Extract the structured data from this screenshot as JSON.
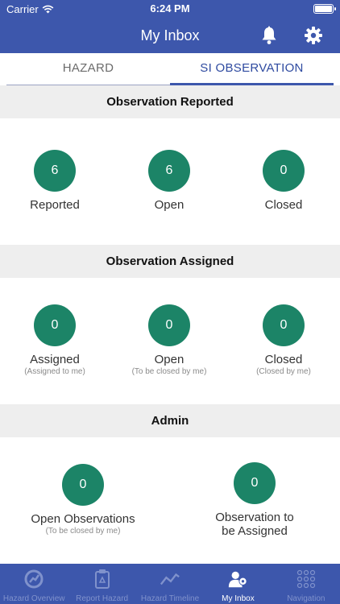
{
  "status_bar": {
    "carrier": "Carrier",
    "time": "6:24 PM"
  },
  "nav": {
    "title": "My Inbox"
  },
  "tabs": [
    {
      "label": "HAZARD",
      "active": false
    },
    {
      "label": "SI OBSERVATION",
      "active": true
    }
  ],
  "observation_reported": {
    "title": "Observation Reported",
    "stats": [
      {
        "value": "6",
        "label": "Reported"
      },
      {
        "value": "6",
        "label": "Open"
      },
      {
        "value": "0",
        "label": "Closed"
      }
    ]
  },
  "observation_assigned": {
    "title": "Observation Assigned",
    "stats": [
      {
        "value": "0",
        "label": "Assigned",
        "sub": "(Assigned to me)"
      },
      {
        "value": "0",
        "label": "Open",
        "sub": "(To be closed by me)"
      },
      {
        "value": "0",
        "label": "Closed",
        "sub": "(Closed by me)"
      }
    ]
  },
  "admin": {
    "title": "Admin",
    "stats": [
      {
        "value": "0",
        "label": "Open Observations",
        "sub": "(To be closed by me)"
      },
      {
        "value": "0",
        "label_line1": "Observation to",
        "label_line2": "be Assigned"
      }
    ]
  },
  "bottom_tabs": [
    {
      "label": "Hazard Overview",
      "icon": "hazard-overview-icon",
      "active": false
    },
    {
      "label": "Report Hazard",
      "icon": "report-hazard-icon",
      "active": false
    },
    {
      "label": "Hazard Timeline",
      "icon": "hazard-timeline-icon",
      "active": false
    },
    {
      "label": "My Inbox",
      "icon": "my-inbox-icon",
      "active": true
    },
    {
      "label": "Navigation",
      "icon": "navigation-grid-icon",
      "active": false
    }
  ],
  "colors": {
    "primary": "#3d57ac",
    "circle": "#1c8467",
    "section_bg": "#eeeeee"
  }
}
